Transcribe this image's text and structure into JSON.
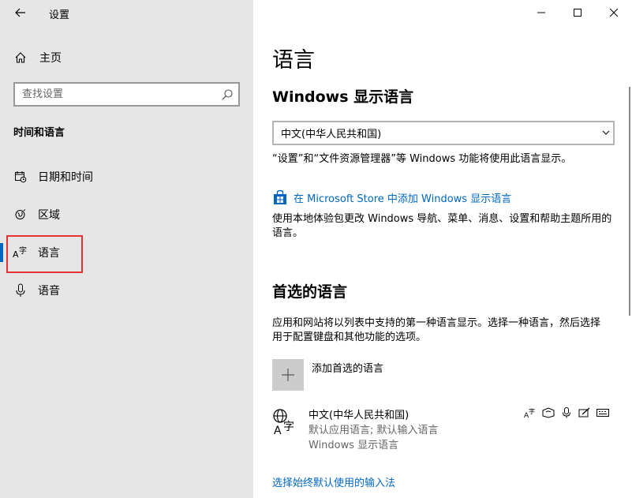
{
  "window": {
    "title": "设置",
    "controls": {
      "minimize": "minimize",
      "maximize": "maximize",
      "close": "close"
    }
  },
  "sidebar": {
    "home_label": "主页",
    "search_placeholder": "查找设置",
    "section_label": "时间和语言",
    "items": [
      {
        "label": "日期和时间",
        "icon": "calendar-clock-icon"
      },
      {
        "label": "区域",
        "icon": "globe-region-icon"
      },
      {
        "label": "语言",
        "icon": "language-icon",
        "selected": true
      },
      {
        "label": "语音",
        "icon": "microphone-icon"
      }
    ],
    "accent_color": "#0067c0",
    "highlight_color": "#e3342f"
  },
  "main": {
    "page_title": "语言",
    "display_language": {
      "heading": "Windows 显示语言",
      "selected_value": "中文(中华人民共和国)",
      "note": "“设置”和“文件资源管理器”等 Windows 功能将使用此语言显示。",
      "store_link": "在 Microsoft Store 中添加 Windows 显示语言",
      "store_desc": "使用本地体验包更改 Windows 导航、菜单、消息、设置和帮助主题所用的语言。"
    },
    "preferred": {
      "heading": "首选的语言",
      "desc": "应用和网站将以列表中支持的第一种语言显示。选择一种语言，然后选择用于配置键盘和其他功能的选项。",
      "add_label": "添加首选的语言",
      "languages": [
        {
          "name": "中文(中华人民共和国)",
          "line1": "默认应用语言; 默认输入语言",
          "line2": "Windows 显示语言",
          "feature_icons": [
            "display-language-icon",
            "text-to-speech-icon",
            "speech-recognition-icon",
            "handwriting-icon",
            "keyboard-icon"
          ]
        }
      ]
    },
    "bottom_link": "选择始终默认使用的输入法"
  }
}
